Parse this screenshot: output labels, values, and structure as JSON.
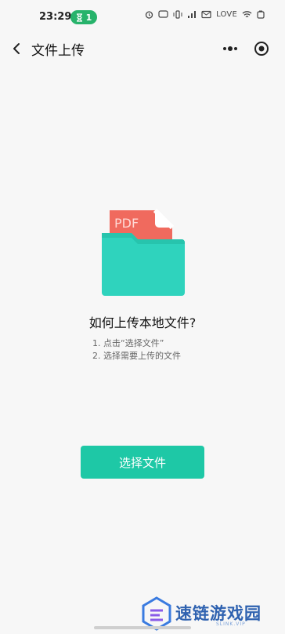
{
  "status": {
    "time": "23:29",
    "badge_count": "1",
    "love_label": "LOVE"
  },
  "header": {
    "title": "文件上传"
  },
  "illustration": {
    "badge_text": "PDF"
  },
  "content": {
    "heading": "如何上传本地文件?",
    "steps": [
      "1. 点击“选择文件”",
      "2. 选择需要上传的文件"
    ]
  },
  "button": {
    "label": "选择文件"
  },
  "watermark": {
    "text": "速链游戏园",
    "sub": "SLINK.VIP"
  },
  "colors": {
    "accent": "#1ec8a6",
    "folder": "#2fd3bd",
    "pdf_card": "#f06a5e"
  }
}
